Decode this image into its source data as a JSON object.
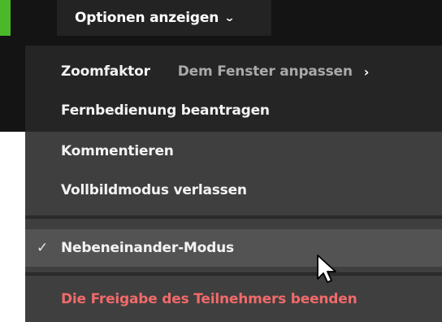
{
  "toolbar": {
    "options_label": "Optionen anzeigen",
    "options_chevron": "⌄",
    "accent_color": "#4bb82a"
  },
  "menu": {
    "zoom_label": "Zoomfaktor",
    "zoom_value": "Dem Fenster anpassen",
    "zoom_arrow": "›",
    "remote_control": "Fernbedienung beantragen",
    "annotate": "Kommentieren",
    "exit_fullscreen": "Vollbildmodus verlassen",
    "side_by_side": "Nebeneinander-Modus",
    "side_by_side_checked": true,
    "check_mark": "✓",
    "stop_sharing": "Die Freigabe des Teilnehmers beenden",
    "stop_sharing_color": "#f06a6a"
  },
  "icons": {
    "cursor": "mouse-pointer-icon",
    "chevron": "chevron-down-icon",
    "submenu": "chevron-right-icon",
    "check": "check-icon"
  }
}
